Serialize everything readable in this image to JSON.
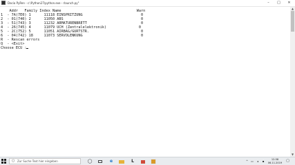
{
  "window": {
    "title": "Dacia PyRen - c:\\Python27\\python.exe - rlaunch.py\"",
    "minimize": "–",
    "maximize": "□",
    "close": "✕"
  },
  "console": {
    "header": "    Addr   Family Index Name                                   Warn",
    "rows": [
      "1  - 7A(7E0) 1      11118 EINSPRITZUNG                           0",
      "2  - 01(740) 2      11050 ABS                                    0",
      "3  - 51(743) 3      11232 ARMATURENBRETT                         0",
      "4  - 26(745) 4      11079 UCH (Zentralelektronik)               0",
      "5  - 2C(752) 5      11051 AIRBAG/GURTSTR.                        0",
      "6  - 04(742) 18     11073 SERVOLENKUNG                           0"
    ],
    "rescan": "R  - Rescan errors",
    "exit": "Q  - <Exit>",
    "prompt": "Choose ECU :"
  },
  "taskbar": {
    "search_placeholder": "Zur Suche Text hier eingeben",
    "icons": [
      "task-view-icon",
      "edge-icon",
      "explorer-icon",
      "store-icon",
      "launcher-icon",
      "terminal-icon"
    ],
    "tray_up": "^",
    "time": "12:58",
    "date": "06.11.2019"
  }
}
